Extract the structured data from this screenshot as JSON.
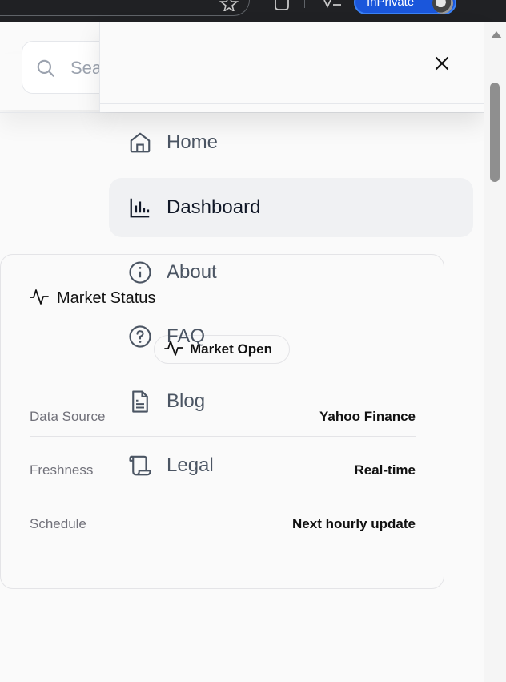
{
  "browser": {
    "profile_label": "InPrivate"
  },
  "search": {
    "placeholder": "Sea"
  },
  "menu": {
    "items": [
      {
        "label": "Home",
        "icon": "home-icon"
      },
      {
        "label": "Dashboard",
        "icon": "bar-chart-icon",
        "active": true
      },
      {
        "label": "About",
        "icon": "info-icon"
      },
      {
        "label": "FAQ",
        "icon": "help-circle-icon"
      },
      {
        "label": "Blog",
        "icon": "file-text-icon"
      },
      {
        "label": "Legal",
        "icon": "scroll-icon"
      }
    ]
  },
  "market": {
    "title": "Market Status",
    "badge": "Market Open",
    "rows": [
      {
        "label": "Data Source",
        "value": "Yahoo Finance"
      },
      {
        "label": "Freshness",
        "value": "Real-time"
      },
      {
        "label": "Schedule",
        "value": "Next hourly update"
      }
    ]
  },
  "colors": {
    "active_item_bg": "#f0f1f3",
    "profile_pill": "#1a56db"
  }
}
